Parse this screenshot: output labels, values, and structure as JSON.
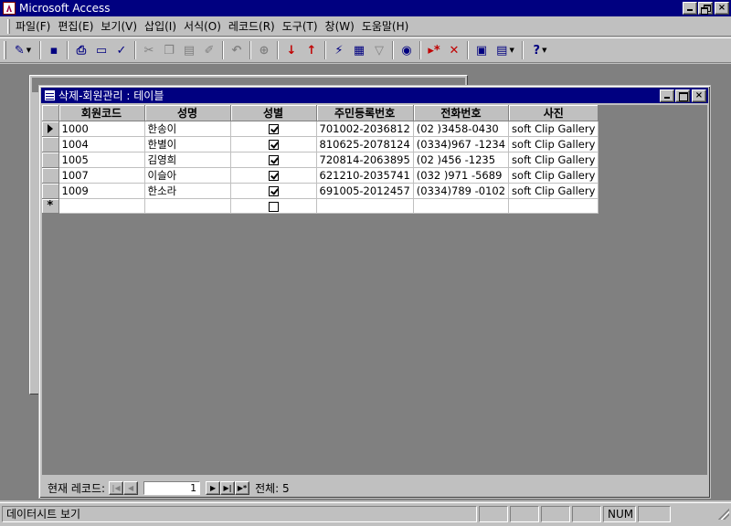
{
  "app": {
    "title": "Microsoft Access"
  },
  "menu": [
    {
      "label": "파일(F)"
    },
    {
      "label": "편집(E)"
    },
    {
      "label": "보기(V)"
    },
    {
      "label": "삽입(I)"
    },
    {
      "label": "서식(O)"
    },
    {
      "label": "레코드(R)"
    },
    {
      "label": "도구(T)"
    },
    {
      "label": "창(W)"
    },
    {
      "label": "도움말(H)"
    }
  ],
  "toolbar": {
    "icons": [
      "design-view-icon",
      "save-icon",
      "print-icon",
      "print-preview-icon",
      "spelling-icon",
      "cut-icon",
      "copy-icon",
      "paste-icon",
      "format-painter-icon",
      "undo-icon",
      "insert-hyperlink-icon",
      "sort-ascending-icon",
      "sort-descending-icon",
      "filter-by-selection-icon",
      "filter-by-form-icon",
      "apply-filter-icon",
      "find-icon",
      "new-record-icon",
      "delete-record-icon",
      "database-window-icon",
      "new-object-icon",
      "help-icon"
    ]
  },
  "table_window": {
    "title": "삭제-회원관리 : 테이블",
    "columns": [
      "회원코드",
      "성명",
      "성별",
      "주민등록번호",
      "전화번호",
      "사진"
    ],
    "rows": [
      {
        "code": "1000",
        "name": "한송이",
        "gender": true,
        "ssn": "701002-2036812",
        "phone": "(02  )3458-0430",
        "photo": "soft Clip Gallery"
      },
      {
        "code": "1004",
        "name": "한별이",
        "gender": true,
        "ssn": "810625-2078124",
        "phone": "(0334)967 -1234",
        "photo": "soft Clip Gallery"
      },
      {
        "code": "1005",
        "name": "김영희",
        "gender": true,
        "ssn": "720814-2063895",
        "phone": "(02  )456 -1235",
        "photo": "soft Clip Gallery"
      },
      {
        "code": "1007",
        "name": "이슬아",
        "gender": true,
        "ssn": "621210-2035741",
        "phone": "(032 )971 -5689",
        "photo": "soft Clip Gallery"
      },
      {
        "code": "1009",
        "name": "한소라",
        "gender": true,
        "ssn": "691005-2012457",
        "phone": "(0334)789 -0102",
        "photo": "soft Clip Gallery"
      }
    ],
    "new_row_gender": false,
    "nav": {
      "label": "현재 레코드:",
      "current": "1",
      "total_label": "전체: 5"
    }
  },
  "status": {
    "text": "데이터시트 보기",
    "num": "NUM"
  }
}
